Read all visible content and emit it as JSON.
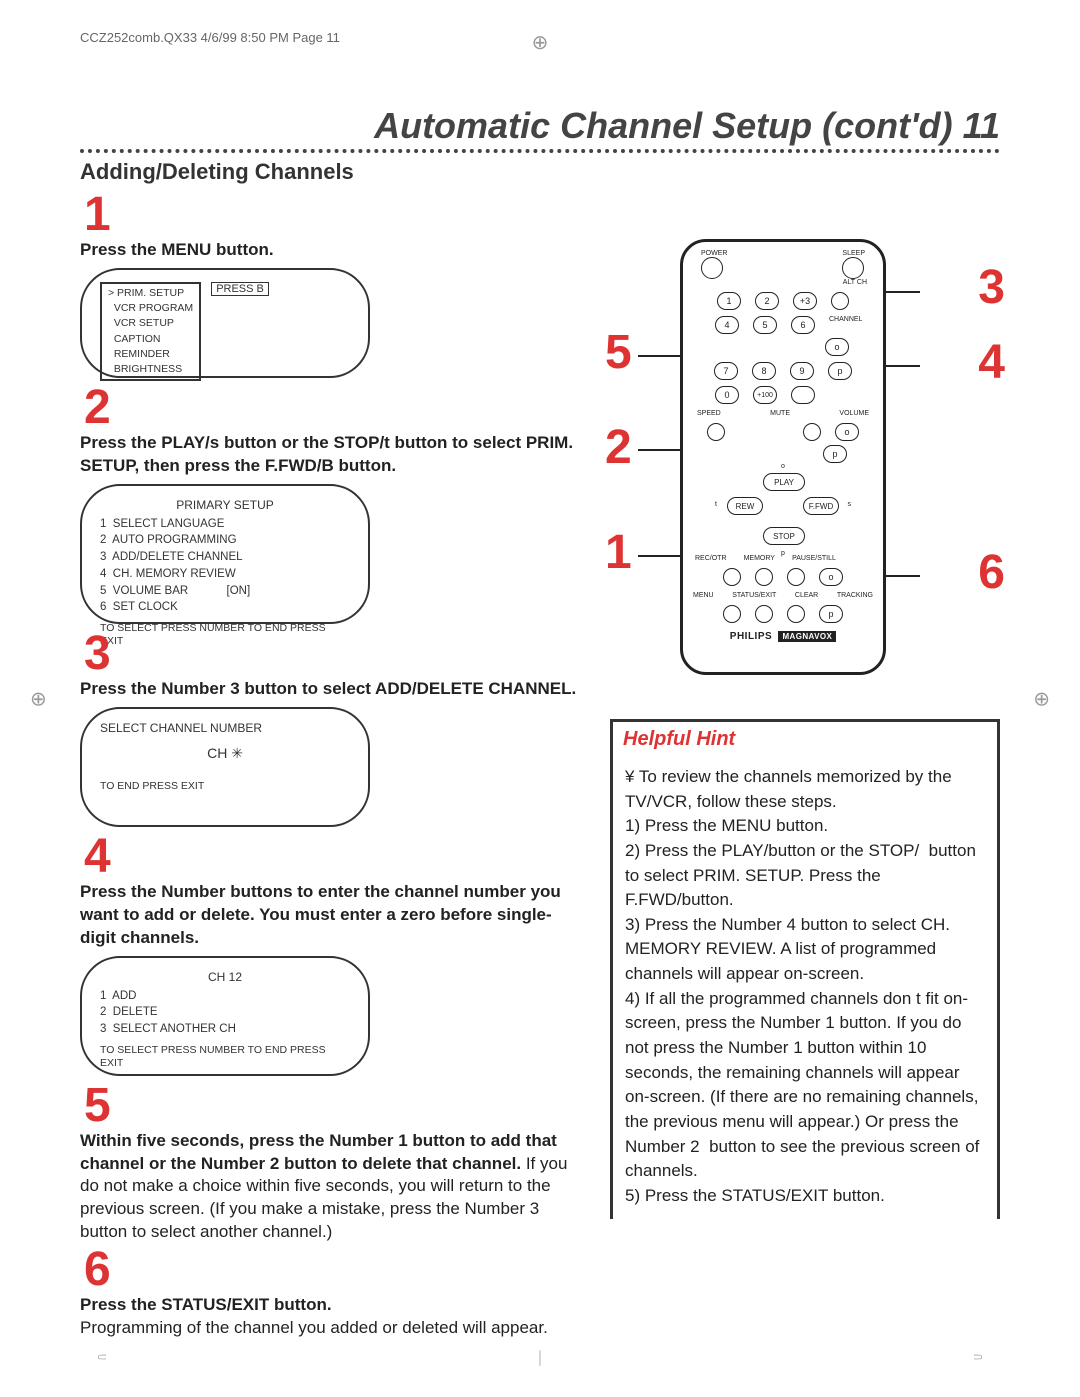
{
  "header_line": "CCZ252comb.QX33  4/6/99  8:50 PM  Page 11",
  "title": "Automatic Channel Setup (cont'd)  11",
  "subtitle": "Adding/Deleting Channels",
  "steps": {
    "s1": {
      "num": "1",
      "text": "Press the MENU button."
    },
    "s2": {
      "num": "2",
      "text": "Press the PLAY/s  button or the STOP/t  button to select PRIM. SETUP, then press the F.FWD/B  button."
    },
    "s3": {
      "num": "3",
      "text": "Press the Number 3 button to select ADD/DELETE CHANNEL."
    },
    "s4": {
      "num": "4",
      "text": "Press the Number buttons to enter the channel number you want to add or delete. You must enter a zero before single-digit channels."
    },
    "s5": {
      "num": "5",
      "bold": "Within five seconds, press the Number 1 button to add that channel or the Number 2 button to delete that channel.",
      "tail": "  If you do not make a choice within five seconds, you will return to the previous screen. (If you make a mistake, press the Number 3 button to select another channel.)"
    },
    "s6": {
      "num": "6",
      "bold": "Press the STATUS/EXIT button.",
      "tail": "Programming of the channel you added or deleted will appear."
    }
  },
  "screen1": {
    "menu_lines": "> PRIM. SETUP\n  VCR PROGRAM\n  VCR SETUP\n  CAPTION\n  REMINDER\n  BRIGHTNESS",
    "press": "PRESS B"
  },
  "screen2": {
    "title": "PRIMARY SETUP",
    "lines": "1  SELECT LANGUAGE\n2  AUTO PROGRAMMING\n3  ADD/DELETE CHANNEL\n4  CH. MEMORY REVIEW\n5  VOLUME BAR            [ON]\n6  SET CLOCK",
    "foot": "TO SELECT PRESS NUMBER\nTO END PRESS EXIT"
  },
  "screen3": {
    "title": "SELECT CHANNEL NUMBER",
    "ch": "CH ✳",
    "foot": "TO END PRESS EXIT"
  },
  "screen4": {
    "title": "CH 12",
    "lines": "1  ADD\n2  DELETE\n3  SELECT ANOTHER CH",
    "foot": "TO SELECT PRESS NUMBER\nTO END PRESS EXIT"
  },
  "remote": {
    "top_labels": {
      "power": "POWER",
      "sleep": "SLEEP",
      "altch": "ALT CH"
    },
    "num": [
      "1",
      "2",
      "3",
      "4",
      "5",
      "6",
      "7",
      "8",
      "9",
      "0",
      "+100"
    ],
    "numext": "+3",
    "mid_labels": {
      "speed": "SPEED",
      "mute": "MUTE",
      "volume": "VOLUME",
      "channel": "CHANNEL"
    },
    "pad": {
      "play": "PLAY",
      "rew": "REW",
      "ffwd": "F.FWD",
      "stop": "STOP"
    },
    "arrows": {
      "up": "o",
      "down": "p",
      "left": "t",
      "right": "s"
    },
    "bottom_row1": {
      "recotr": "REC/OTR",
      "memory": "MEMORY",
      "pausestill": "PAUSE/STILL"
    },
    "bottom_row2": {
      "menu": "MENU",
      "statusexit": "STATUS/EXIT",
      "clear": "CLEAR",
      "tracking": "TRACKING"
    },
    "bottom_side": {
      "o": "o",
      "p": "p"
    },
    "brand": "PHILIPS",
    "brand2": "MAGNAVOX"
  },
  "callouts": {
    "c1": "1",
    "c2": "2",
    "c3": "3",
    "c4": "4",
    "c5": "5",
    "c6": "6"
  },
  "hint": {
    "title": "Helpful Hint",
    "bullet": "¥",
    "body": " To review the channels memorized by the TV/VCR, follow these steps.\n1) Press the MENU button.\n2) Press the PLAY/button or the STOP/  button to select PRIM. SETUP. Press the F.FWD/button.\n3) Press the Number 4 button to select CH. MEMORY REVIEW. A list of programmed channels will appear on-screen.\n4) If all the programmed channels don t fit on-screen, press the Number 1 button. If you do not press the Number 1 button within 10 seconds, the remaining channels will appear on-screen. (If there are no remaining channels, the previous menu will appear.) Or press the Number 2  button to see the previous screen of channels.\n5) Press the STATUS/EXIT button."
  }
}
